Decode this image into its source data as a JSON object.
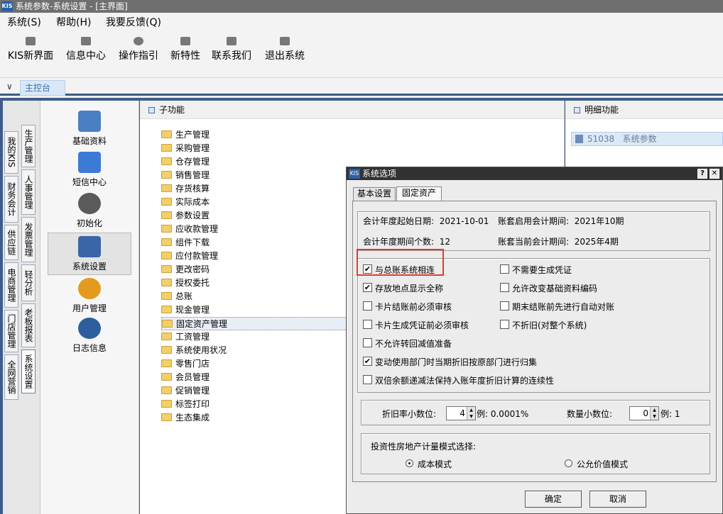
{
  "window": {
    "title": "系统参数-系统设置 - [主界面]",
    "logo": "KIS"
  },
  "menu": [
    "系统(S)",
    "帮助(H)",
    "我要反馈(Q)"
  ],
  "toolbar": [
    {
      "label": "KIS新界面",
      "icon": "layout-icon"
    },
    {
      "label": "信息中心",
      "icon": "mail-icon"
    },
    {
      "label": "操作指引",
      "icon": "guide-icon"
    },
    {
      "label": "新特性",
      "icon": "star-icon"
    },
    {
      "label": "联系我们",
      "icon": "chat-icon"
    },
    {
      "label": "退出系统",
      "icon": "exit-icon"
    }
  ],
  "tabbar": {
    "chevron": "∨",
    "active_tab": "主控台"
  },
  "vtabs_left": [
    "我的KIS",
    "财务会计",
    "供应链",
    "电商管理",
    "门店管理",
    "全网营销"
  ],
  "vtabs_right": [
    "生产管理",
    "人事管理",
    "发票管理",
    "轻分析",
    "老板报表",
    "系统设置"
  ],
  "icon_items": [
    {
      "label": "基础资料",
      "color": "#4b7fc4"
    },
    {
      "label": "短信中心",
      "color": "#3d7ad6"
    },
    {
      "label": "初始化",
      "color": "#5a5a5a"
    },
    {
      "label": "系统设置",
      "color": "#3a66a8"
    },
    {
      "label": "用户管理",
      "color": "#e39a1e"
    },
    {
      "label": "日志信息",
      "color": "#2d5f9e"
    }
  ],
  "subpanel": {
    "title": "子功能",
    "items": [
      "生产管理",
      "采购管理",
      "仓存管理",
      "销售管理",
      "存货核算",
      "实际成本",
      "参数设置",
      "应收款管理",
      "组件下载",
      "应付款管理",
      "更改密码",
      "授权委托",
      "总账",
      "现金管理",
      "固定资产管理",
      "工资管理",
      "系统使用状况",
      "零售门店",
      "会员管理",
      "促销管理",
      "标签打印",
      "生态集成"
    ],
    "selected": "固定资产管理"
  },
  "detail": {
    "title": "明细功能",
    "row_code": "51038",
    "row_label": "系统参数"
  },
  "dialog": {
    "title": "系统选项",
    "title_buttons": [
      "?",
      "✕"
    ],
    "tabs": [
      "基本设置",
      "固定资产"
    ],
    "active_tab": "固定资产",
    "info": {
      "start_date_label": "会计年度起始日期:",
      "start_date": "2021-10-01",
      "enable_period_label": "账套启用会计期间:",
      "enable_period": "2021年10期",
      "period_count_label": "会计年度期间个数:",
      "period_count": "12",
      "current_period_label": "账套当前会计期间:",
      "current_period": "2025年4期"
    },
    "options_left": [
      {
        "label": "与总账系统相连",
        "checked": true
      },
      {
        "label": "存放地点显示全称",
        "checked": true
      },
      {
        "label": "卡片结账前必须审核",
        "checked": false
      },
      {
        "label": "卡片生成凭证前必须审核",
        "checked": false
      },
      {
        "label": "不允许转回减值准备",
        "checked": false
      },
      {
        "label": "变动使用部门时当期折旧按原部门进行归集",
        "checked": true
      },
      {
        "label": "双倍余额递减法保持入账年度折旧计算的连续性",
        "checked": false
      }
    ],
    "options_right": [
      {
        "label": "不需要生成凭证",
        "checked": false
      },
      {
        "label": "允许改变基础资料编码",
        "checked": false
      },
      {
        "label": "期末结账前先进行自动对账",
        "checked": false
      },
      {
        "label": "不折旧(对整个系统)",
        "checked": false
      }
    ],
    "decimal": {
      "rate_label": "折旧率小数位:",
      "rate_value": "4",
      "rate_example": "例: 0.0001%",
      "qty_label": "数量小数位:",
      "qty_value": "0",
      "qty_example": "例: 1"
    },
    "realestate": {
      "label": "投资性房地产计量模式选择:",
      "options": [
        "成本模式",
        "公允价值模式"
      ],
      "selected": "成本模式"
    },
    "buttons": {
      "ok": "确定",
      "cancel": "取消"
    },
    "highlight_color": "#e23b2e"
  }
}
